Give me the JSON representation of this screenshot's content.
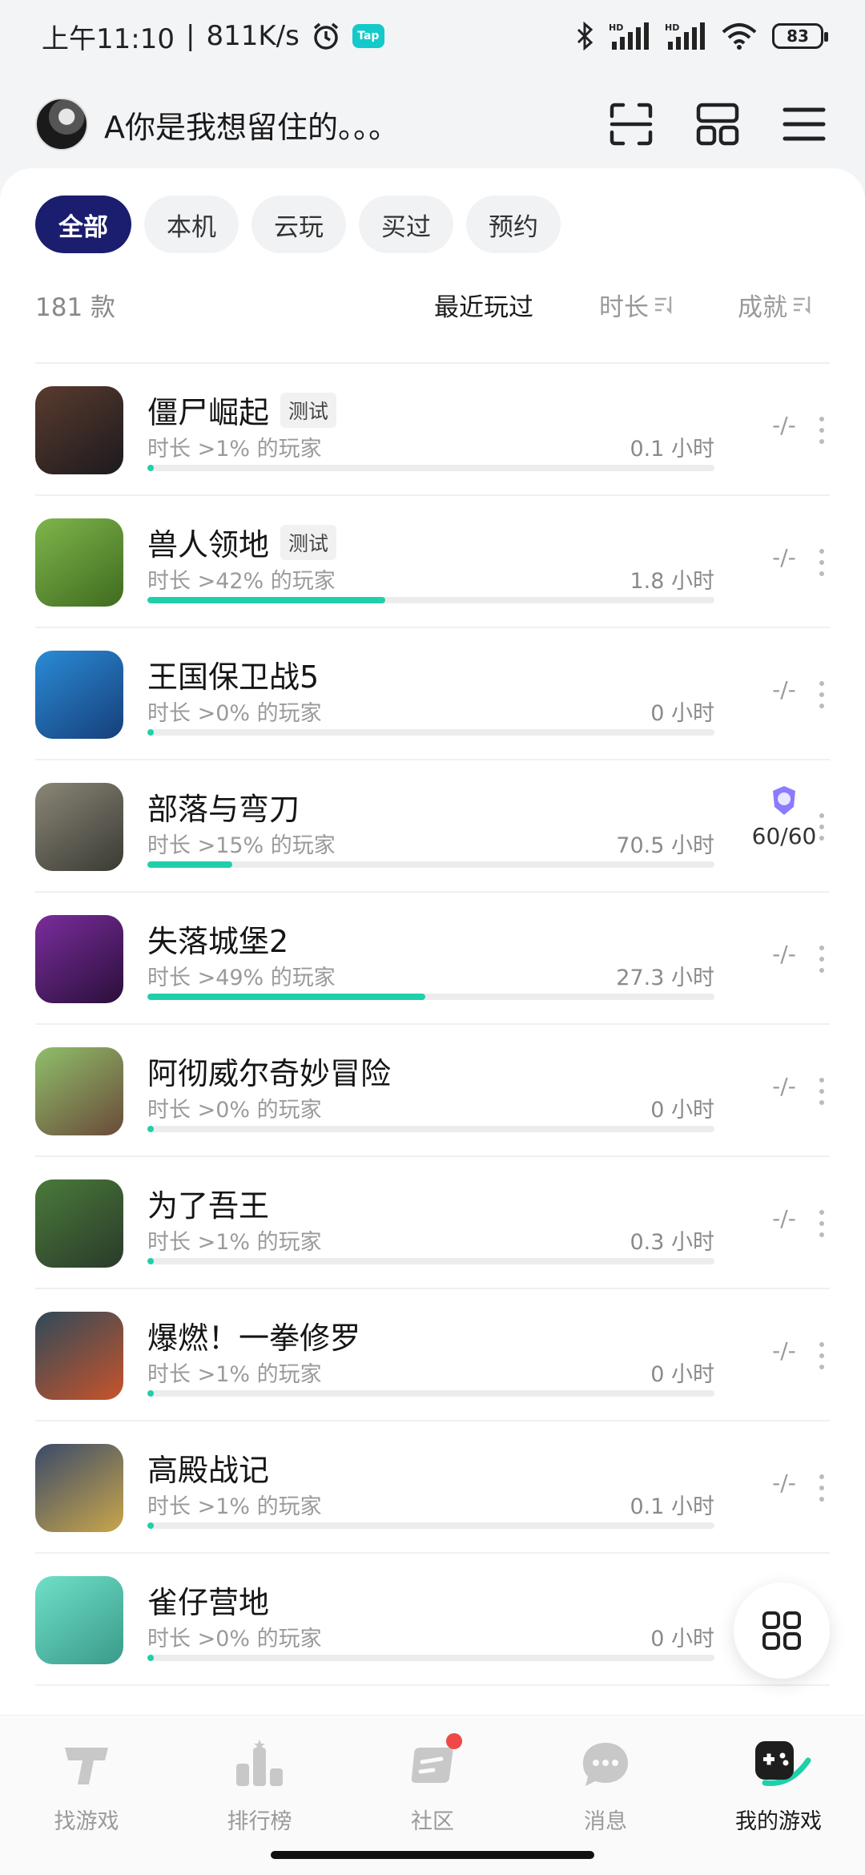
{
  "status_bar": {
    "time": "上午11:10",
    "speed": "811K/s",
    "battery": "83"
  },
  "header": {
    "username": "A你是我想留住的。。。"
  },
  "filters": [
    {
      "label": "全部"
    },
    {
      "label": "本机"
    },
    {
      "label": "云玩"
    },
    {
      "label": "买过"
    },
    {
      "label": "预约"
    }
  ],
  "sortbar": {
    "count": "181 款",
    "recent": "最近玩过",
    "duration": "时长",
    "achievement": "成就"
  },
  "games": [
    {
      "name": "僵尸崛起",
      "tag": "测试",
      "playtext": "时长 >1% 的玩家",
      "hours": "0.1 小时",
      "progress": 0.01,
      "achievement": "-/-",
      "colors": [
        "#5a3b2e",
        "#1c1a1e"
      ]
    },
    {
      "name": "兽人领地",
      "tag": "测试",
      "playtext": "时长 >42% 的玩家",
      "hours": "1.8 小时",
      "progress": 0.42,
      "achievement": "-/-",
      "colors": [
        "#7fb54b",
        "#3f6b1f"
      ]
    },
    {
      "name": "王国保卫战5",
      "tag": "",
      "playtext": "时长 >0% 的玩家",
      "hours": "0 小时",
      "progress": 0.0,
      "achievement": "-/-",
      "colors": [
        "#2a8bd6",
        "#163f7a"
      ]
    },
    {
      "name": "部落与弯刀",
      "tag": "",
      "playtext": "时长 >15% 的玩家",
      "hours": "70.5 小时",
      "progress": 0.15,
      "achievement": "60/60",
      "colors": [
        "#8a8677",
        "#3a3a34"
      ]
    },
    {
      "name": "失落城堡2",
      "tag": "",
      "playtext": "时长 >49% 的玩家",
      "hours": "27.3 小时",
      "progress": 0.49,
      "achievement": "-/-",
      "colors": [
        "#7a2d9c",
        "#2a0f3a"
      ]
    },
    {
      "name": "阿彻威尔奇妙冒险",
      "tag": "",
      "playtext": "时长 >0% 的玩家",
      "hours": "0 小时",
      "progress": 0.0,
      "achievement": "-/-",
      "colors": [
        "#8fbf6a",
        "#6a4a3a"
      ]
    },
    {
      "name": "为了吾王",
      "tag": "",
      "playtext": "时长 >1% 的玩家",
      "hours": "0.3 小时",
      "progress": 0.01,
      "achievement": "-/-",
      "colors": [
        "#4a7a3a",
        "#2a3a2a"
      ]
    },
    {
      "name": "爆燃！一拳修罗",
      "tag": "",
      "playtext": "时长 >1% 的玩家",
      "hours": "0 小时",
      "progress": 0.01,
      "achievement": "-/-",
      "colors": [
        "#2e4a5a",
        "#c8532a"
      ]
    },
    {
      "name": "高殿战记",
      "tag": "",
      "playtext": "时长 >1% 的玩家",
      "hours": "0.1 小时",
      "progress": 0.01,
      "achievement": "-/-",
      "colors": [
        "#3a4a6a",
        "#c9a64a"
      ]
    },
    {
      "name": "雀仔营地",
      "tag": "",
      "playtext": "时长 >0% 的玩家",
      "hours": "0 小时",
      "progress": 0.0,
      "achievement": "",
      "colors": [
        "#6fe0c8",
        "#3a9a8a"
      ]
    }
  ],
  "tabbar": [
    {
      "label": "找游戏",
      "icon": "tap-logo-icon"
    },
    {
      "label": "排行榜",
      "icon": "ranking-icon"
    },
    {
      "label": "社区",
      "icon": "community-icon"
    },
    {
      "label": "消息",
      "icon": "message-icon"
    },
    {
      "label": "我的游戏",
      "icon": "my-games-icon"
    }
  ],
  "accent_color": "#1fcfaa",
  "active_chip_color": "#1b1d6e"
}
